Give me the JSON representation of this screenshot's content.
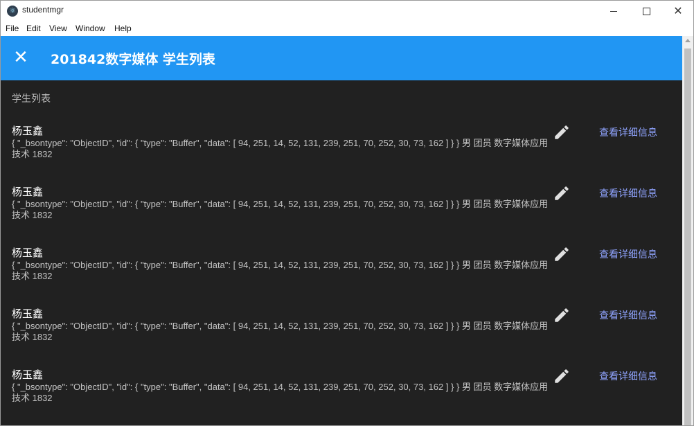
{
  "window": {
    "title": "studentmgr",
    "app_icon": "electron-icon",
    "minimize_icon": "minimize-icon",
    "maximize_icon": "maximize-icon",
    "close_glyph": "✕"
  },
  "menu": {
    "items": [
      "File",
      "Edit",
      "View",
      "Window",
      "Help"
    ]
  },
  "appbar": {
    "close_glyph": "✕",
    "title": "201842数字媒体 学生列表",
    "color": "#2196f3"
  },
  "list": {
    "header": "学生列表",
    "detail_label": "查看详细信息",
    "edit_icon": "pencil-icon",
    "items": [
      {
        "name": "杨玉鑫",
        "description": "{ \"_bsontype\": \"ObjectID\", \"id\": { \"type\": \"Buffer\", \"data\": [ 94, 251, 14, 52, 131, 239, 251, 70, 252, 30, 73, 162 ] } } 男 团员 数字媒体应用技术 1832"
      },
      {
        "name": "杨玉鑫",
        "description": "{ \"_bsontype\": \"ObjectID\", \"id\": { \"type\": \"Buffer\", \"data\": [ 94, 251, 14, 52, 131, 239, 251, 70, 252, 30, 73, 162 ] } } 男 团员 数字媒体应用技术 1832"
      },
      {
        "name": "杨玉鑫",
        "description": "{ \"_bsontype\": \"ObjectID\", \"id\": { \"type\": \"Buffer\", \"data\": [ 94, 251, 14, 52, 131, 239, 251, 70, 252, 30, 73, 162 ] } } 男 团员 数字媒体应用技术 1832"
      },
      {
        "name": "杨玉鑫",
        "description": "{ \"_bsontype\": \"ObjectID\", \"id\": { \"type\": \"Buffer\", \"data\": [ 94, 251, 14, 52, 131, 239, 251, 70, 252, 30, 73, 162 ] } } 男 团员 数字媒体应用技术 1832"
      },
      {
        "name": "杨玉鑫",
        "description": "{ \"_bsontype\": \"ObjectID\", \"id\": { \"type\": \"Buffer\", \"data\": [ 94, 251, 14, 52, 131, 239, 251, 70, 252, 30, 73, 162 ] } } 男 团员 数字媒体应用技术 1832"
      }
    ]
  }
}
